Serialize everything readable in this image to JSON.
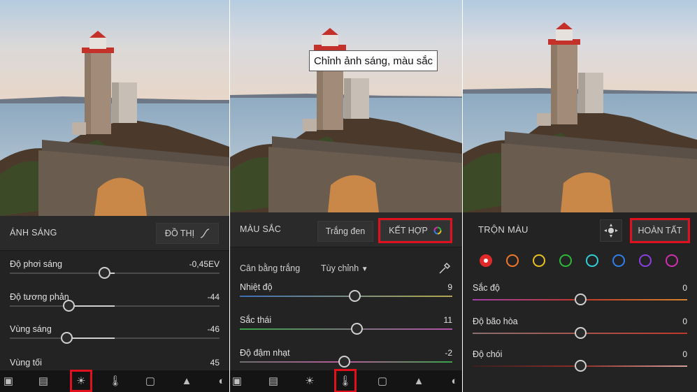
{
  "panel_light": {
    "title": "ÁNH SÁNG",
    "curve_btn": "ĐỒ THỊ",
    "sliders": [
      {
        "label": "Độ phơi sáng",
        "value": "-0,45EV",
        "pos": 0.45
      },
      {
        "label": "Độ tương phản",
        "value": "-44",
        "pos": 0.28
      },
      {
        "label": "Vùng sáng",
        "value": "-46",
        "pos": 0.27
      },
      {
        "label": "Vùng tối",
        "value": "45",
        "pos": 0.72
      }
    ]
  },
  "panel_color": {
    "tooltip": "Chỉnh ảnh sáng, màu sắc",
    "title": "MÀU SẮC",
    "bw_btn": "Trắng đen",
    "mix_btn": "KẾT HỢP",
    "white_balance_label": "Cân bằng trắng",
    "white_balance_value": "Tùy chỉnh",
    "sliders": [
      {
        "label": "Nhiệt độ",
        "value": "9",
        "pos": 0.54
      },
      {
        "label": "Sắc thái",
        "value": "11",
        "pos": 0.55
      },
      {
        "label": "Độ đậm nhạt",
        "value": "-2",
        "pos": 0.49
      }
    ]
  },
  "panel_mix": {
    "title": "TRỘN MÀU",
    "done_btn": "HOÀN TẤT",
    "swatches": [
      {
        "name": "red",
        "color": "#e02a2a"
      },
      {
        "name": "orange",
        "color": "#f0782a"
      },
      {
        "name": "yellow",
        "color": "#e8c21f"
      },
      {
        "name": "green",
        "color": "#2db83a"
      },
      {
        "name": "aqua",
        "color": "#2fd0d8"
      },
      {
        "name": "blue",
        "color": "#2f7fe8"
      },
      {
        "name": "purple",
        "color": "#8a3fe0"
      },
      {
        "name": "magenta",
        "color": "#d02fb0"
      }
    ],
    "sliders": [
      {
        "label": "Sắc độ",
        "value": "0",
        "pos": 0.5
      },
      {
        "label": "Độ bão hòa",
        "value": "0",
        "pos": 0.5
      },
      {
        "label": "Độ chói",
        "value": "0",
        "pos": 0.5
      }
    ]
  },
  "toolbar_icons": [
    "presets-icon",
    "crop-icon",
    "light-icon",
    "color-icon",
    "effects-icon",
    "detail-icon",
    "optics-icon"
  ],
  "accent": "#e0111c"
}
